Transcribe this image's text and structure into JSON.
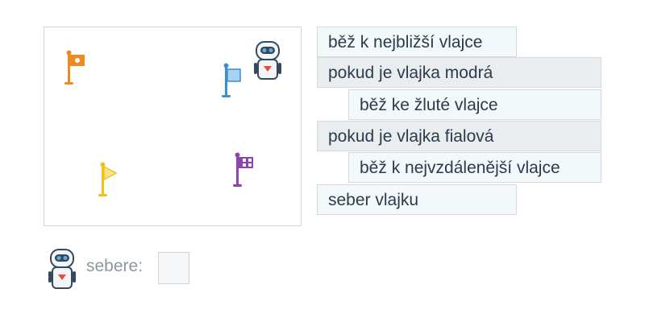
{
  "board": {
    "flags": [
      {
        "name": "orange-flag",
        "color": "#ef8a22",
        "icon": "flag-with-dot"
      },
      {
        "name": "blue-flag",
        "color": "#3d8fcf",
        "icon": "flag"
      },
      {
        "name": "yellow-flag",
        "color": "#f2c01e",
        "icon": "pennant-flag"
      },
      {
        "name": "purple-flag",
        "color": "#8e44ad",
        "icon": "checkered-flag"
      }
    ],
    "robot_icon": "robot"
  },
  "program": {
    "blocks": [
      {
        "label": "běž k nejbližší vlajce",
        "kind": "command"
      },
      {
        "label": "pokud je vlajka modrá",
        "kind": "condition"
      },
      {
        "label": "běž ke žluté vlajce",
        "kind": "command"
      },
      {
        "label": "pokud je vlajka fialová",
        "kind": "condition"
      },
      {
        "label": "běž k nejvzdálenější vlajce",
        "kind": "command"
      },
      {
        "label": "seber vlajku",
        "kind": "command"
      }
    ]
  },
  "collect": {
    "label": "sebere:",
    "robot_icon": "robot"
  },
  "colors": {
    "command_bg": "#f3f8fa",
    "condition_bg": "#e9edef",
    "text": "#2b3b4b",
    "label_muted": "#8b97a3"
  }
}
